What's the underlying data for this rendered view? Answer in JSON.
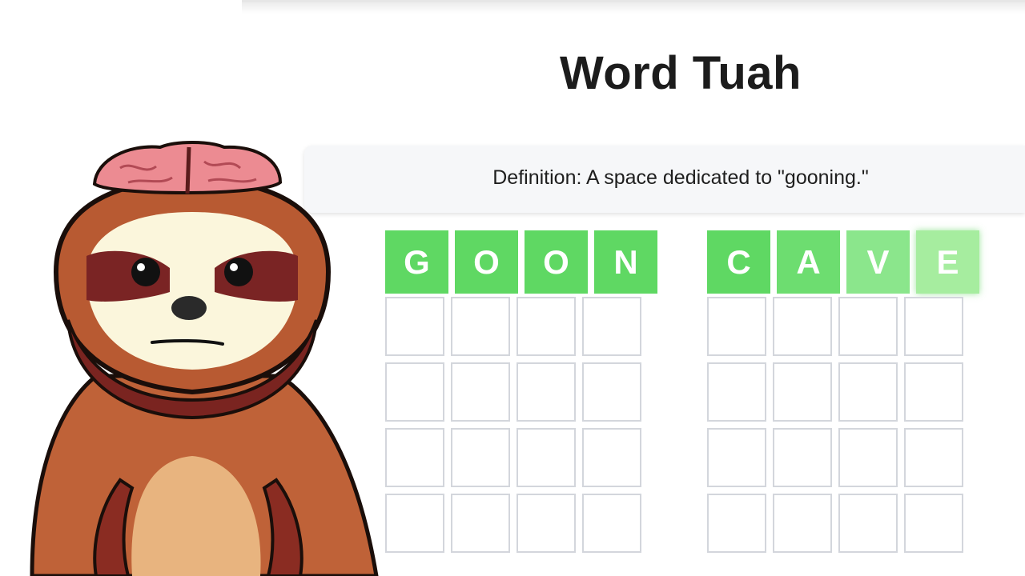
{
  "header": {
    "title": "Word Tuah"
  },
  "definition": {
    "text": "Definition: A space dedicated to \"gooning.\""
  },
  "boards": [
    {
      "name": "left",
      "guess": [
        "G",
        "O",
        "O",
        "N"
      ],
      "empty_rows": 4
    },
    {
      "name": "right",
      "guess": [
        "C",
        "A",
        "V",
        "E"
      ],
      "empty_rows": 4
    }
  ],
  "colors": {
    "correct_tile": "#5fd863",
    "empty_border": "#d3d6dc",
    "sloth_fur": "#c0643c"
  },
  "mascot": {
    "icon": "sloth-with-brain-icon"
  }
}
